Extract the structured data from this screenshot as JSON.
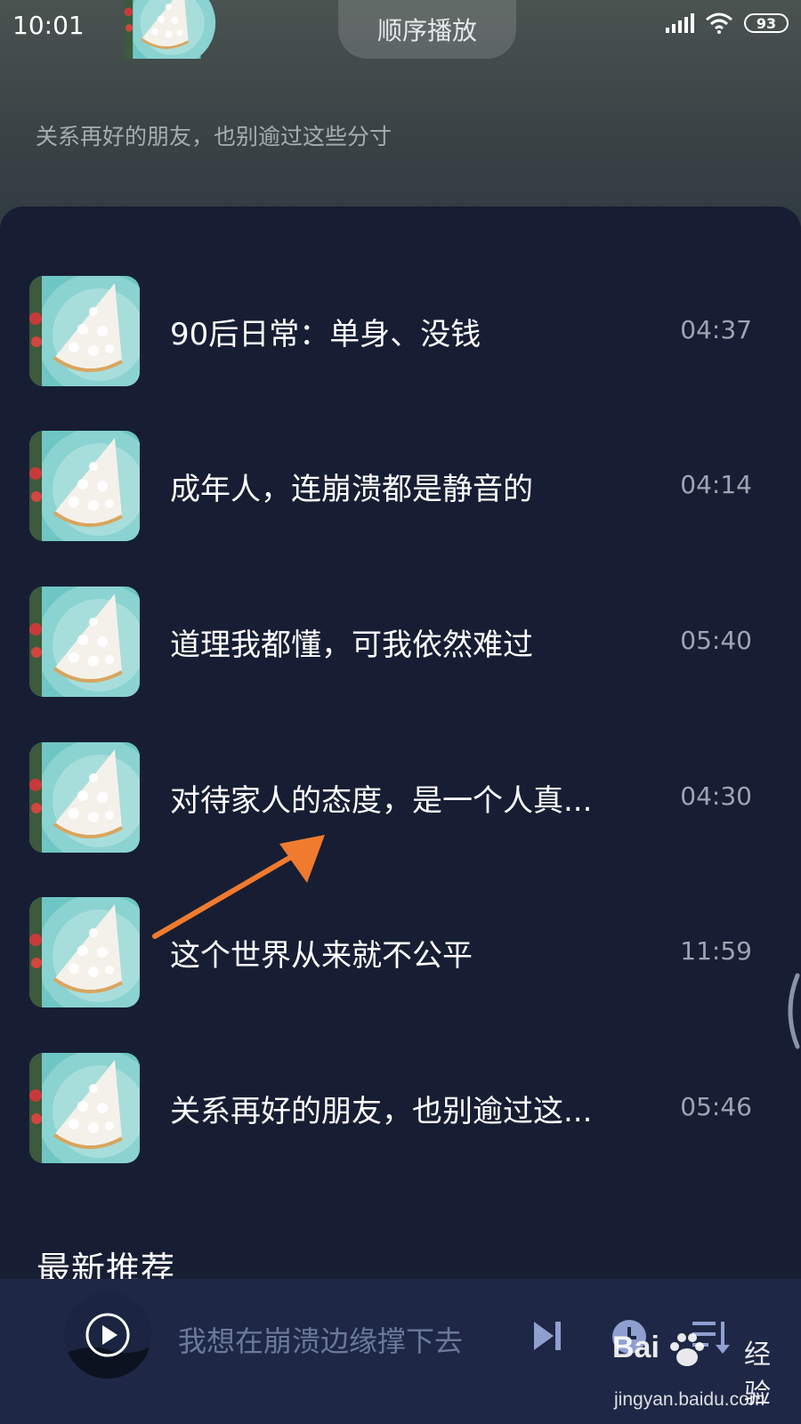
{
  "status_bar": {
    "time": "10:01",
    "battery": "93"
  },
  "header": {
    "play_mode_label": "顺序播放",
    "album_description": "关系再好的朋友，也别逾过这些分寸"
  },
  "tracks": [
    {
      "title": "90后日常：单身、没钱",
      "duration": "04:37"
    },
    {
      "title": "成年人，连崩溃都是静音的",
      "duration": "04:14"
    },
    {
      "title": "道理我都懂，可我依然难过",
      "duration": "05:40"
    },
    {
      "title": "对待家人的态度，是一个人真...",
      "duration": "04:30"
    },
    {
      "title": "这个世界从来就不公平",
      "duration": "11:59"
    },
    {
      "title": "关系再好的朋友，也别逾过这...",
      "duration": "05:46"
    }
  ],
  "section": {
    "title": "最新推荐"
  },
  "mini_player": {
    "title": "我想在崩溃边缘撑下去"
  },
  "watermark": {
    "brand": "Bai",
    "label": "经验",
    "url": "jingyan.baidu.com"
  },
  "icons": {
    "signal": "signal-icon",
    "wifi": "wifi-icon",
    "play": "play-icon",
    "next": "next-track-icon",
    "timer": "clock-icon",
    "playlist": "playlist-icon",
    "annotation": "arrow-annotation"
  },
  "colors": {
    "background": "#171e33",
    "mini_player_bg": "#1e2745",
    "accent_arrow": "#f07a2e",
    "control_icon": "#8f9fd0"
  }
}
